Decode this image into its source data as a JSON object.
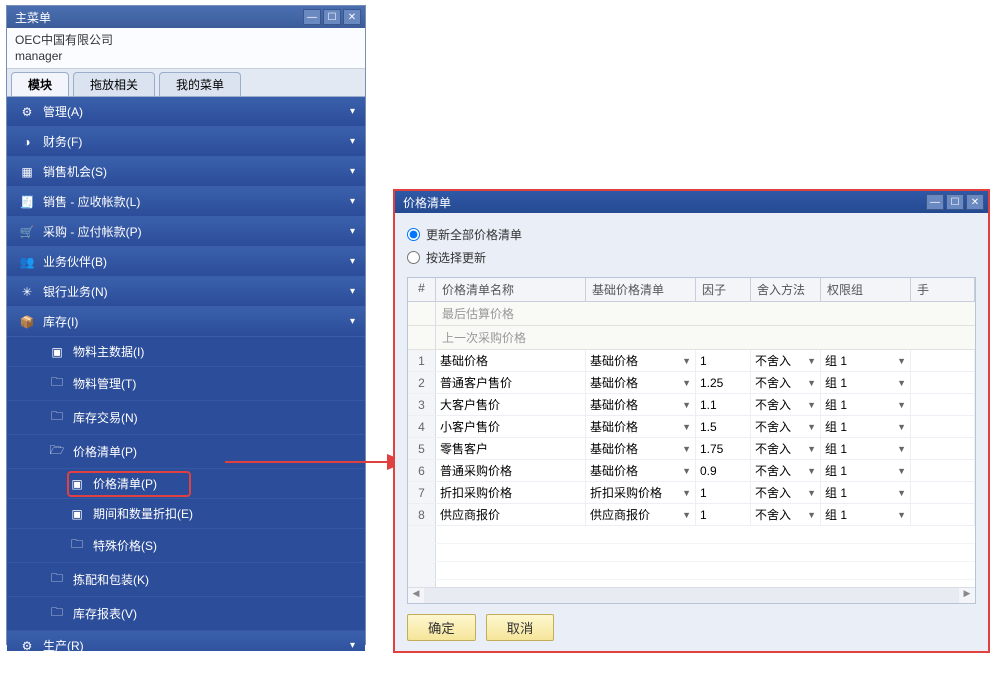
{
  "main_menu": {
    "title": "主菜单",
    "company": "OEC中国有限公司",
    "user": "manager",
    "tabs": {
      "modules": "模块",
      "drag": "拖放相关",
      "mymenu": "我的菜单"
    },
    "items": {
      "admin": "管理(A)",
      "finance": "财务(F)",
      "salesopp": "销售机会(S)",
      "sales_ar": "销售 - 应收帐款(L)",
      "purchase_ap": "采购 - 应付帐款(P)",
      "bp": "业务伙伴(B)",
      "bank": "银行业务(N)",
      "inventory": "库存(I)",
      "inv_master": "物料主数据(I)",
      "inv_mgmt": "物料管理(T)",
      "inv_trans": "库存交易(N)",
      "price_list_folder": "价格清单(P)",
      "price_list_item": "价格清单(P)",
      "period_qty_disc": "期间和数量折扣(E)",
      "special_price": "特殊价格(S)",
      "pick_pack": "拣配和包装(K)",
      "inv_report": "库存报表(V)",
      "production": "生产(R)"
    }
  },
  "price_window": {
    "title": "价格清单",
    "radio_all": "更新全部价格清单",
    "radio_sel": "按选择更新",
    "columns": {
      "num": "#",
      "name": "价格清单名称",
      "base": "基础价格清单",
      "factor": "因子",
      "round": "舍入方法",
      "group": "权限组"
    },
    "special_rows": {
      "last_calc": "最后估算价格",
      "last_purchase": "上一次采购价格"
    },
    "rows": [
      {
        "n": 1,
        "name": "基础价格",
        "base": "基础价格",
        "factor": "1",
        "round": "不舍入",
        "group": "组 1"
      },
      {
        "n": 2,
        "name": "普通客户售价",
        "base": "基础价格",
        "factor": "1.25",
        "round": "不舍入",
        "group": "组 1"
      },
      {
        "n": 3,
        "name": "大客户售价",
        "base": "基础价格",
        "factor": "1.1",
        "round": "不舍入",
        "group": "组 1"
      },
      {
        "n": 4,
        "name": "小客户售价",
        "base": "基础价格",
        "factor": "1.5",
        "round": "不舍入",
        "group": "组 1"
      },
      {
        "n": 5,
        "name": "零售客户",
        "base": "基础价格",
        "factor": "1.75",
        "round": "不舍入",
        "group": "组 1"
      },
      {
        "n": 6,
        "name": "普通采购价格",
        "base": "基础价格",
        "factor": "0.9",
        "round": "不舍入",
        "group": "组 1"
      },
      {
        "n": 7,
        "name": "折扣采购价格",
        "base": "折扣采购价格",
        "factor": "1",
        "round": "不舍入",
        "group": "组 1"
      },
      {
        "n": 8,
        "name": "供应商报价",
        "base": "供应商报价",
        "factor": "1",
        "round": "不舍入",
        "group": "组 1"
      }
    ],
    "buttons": {
      "ok": "确定",
      "cancel": "取消"
    }
  }
}
